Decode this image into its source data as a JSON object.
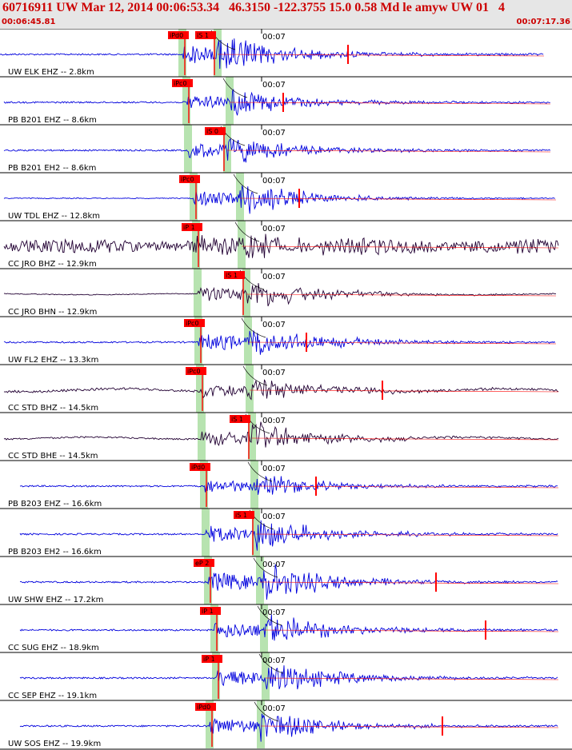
{
  "header": {
    "title": "60716911 UW Mar 12, 2014 00:06:53.34   46.3150 -122.3755 15.0 0.58 Md le amyw UW 01   4",
    "start_time": "00:06:45.81",
    "end_time": "00:07:17.36"
  },
  "colors": {
    "header_bg": "#e6e6e6",
    "title": "#cc0000",
    "trace_blue": "#0000dd",
    "trace_dark": "#220033",
    "pick_red": "#ff0000",
    "window_green": "#b7e3b0",
    "separator": "#000000"
  },
  "minute_marker": "00:07",
  "traces": [
    {
      "label": "UW ELK EHZ -- 2.8km",
      "p_pick": "iPd0",
      "s_pick": "iS 1",
      "color": "blue"
    },
    {
      "label": "PB B201 EHZ -- 8.6km",
      "p_pick": "iPc0",
      "s_pick": "",
      "color": "blue"
    },
    {
      "label": "PB B201 EH2 -- 8.6km",
      "p_pick": "",
      "s_pick": "iS 0",
      "color": "blue"
    },
    {
      "label": "UW TDL EHZ -- 12.8km",
      "p_pick": "iPc0",
      "s_pick": "",
      "color": "blue"
    },
    {
      "label": "CC JRO BHZ -- 12.9km",
      "p_pick": "iP 1",
      "s_pick": "",
      "color": "dark"
    },
    {
      "label": "CC JRO BHN -- 12.9km",
      "p_pick": "",
      "s_pick": "iS 1",
      "color": "dark"
    },
    {
      "label": "UW FL2 EHZ -- 13.3km",
      "p_pick": "iPc0",
      "s_pick": "",
      "color": "blue"
    },
    {
      "label": "CC STD BHZ -- 14.5km",
      "p_pick": "iPc0",
      "s_pick": "",
      "color": "dark"
    },
    {
      "label": "CC STD BHE -- 14.5km",
      "p_pick": "",
      "s_pick": "iS 1",
      "color": "dark"
    },
    {
      "label": "PB B203 EHZ -- 16.6km",
      "p_pick": "iPd0",
      "s_pick": "",
      "color": "blue"
    },
    {
      "label": "PB B203 EH2 -- 16.6km",
      "p_pick": "",
      "s_pick": "iS 1",
      "color": "blue"
    },
    {
      "label": "UW SHW EHZ -- 17.2km",
      "p_pick": "eP 2",
      "s_pick": "",
      "color": "blue"
    },
    {
      "label": "CC SUG EHZ -- 18.9km",
      "p_pick": "iP 1",
      "s_pick": "",
      "color": "blue"
    },
    {
      "label": "CC SEP EHZ -- 19.1km",
      "p_pick": "iP 1",
      "s_pick": "",
      "color": "blue"
    },
    {
      "label": "UW SOS EHZ -- 19.9km",
      "p_pick": "iPd0",
      "s_pick": "",
      "color": "blue"
    }
  ]
}
